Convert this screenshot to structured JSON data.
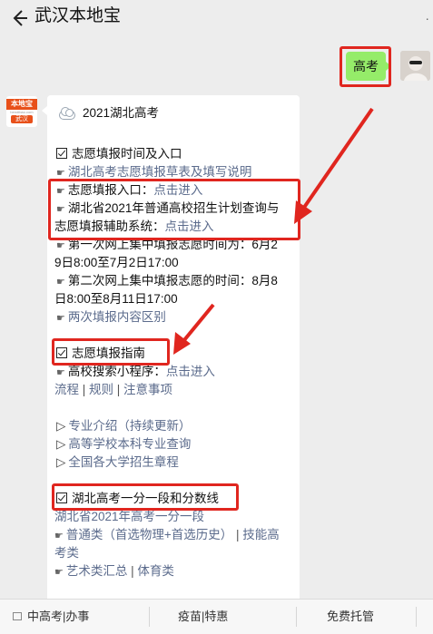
{
  "header": {
    "title": "武汉本地宝",
    "more": "·"
  },
  "chat": {
    "user_message": "高考",
    "bot_avatar": {
      "brand": "本地宝",
      "site": "bendibao.com",
      "city": "武汉"
    }
  },
  "card": {
    "heading": "2021湖北高考",
    "sec1_title": "志愿填报时间及入口",
    "sec1_link1": "湖北高考志愿填报草表及填写说明",
    "entry1_label": "志愿填报入口：",
    "entry1_link": "点击进入",
    "entry2_line1": "湖北省2021年普通高校招生计划查询与",
    "entry2_line2_label": "志愿填报辅助系统：",
    "entry2_link": "点击进入",
    "first_round_line1": "第一次网上集中填报志愿时间为：6月2",
    "first_round_line2": "9日8:00至7月2日17:00",
    "second_round_line1": "第二次网上集中填报志愿的时间：8月8",
    "second_round_line2": "日8:00至8月11日17:00",
    "diff_link": "两次填报内容区别",
    "sec2_title": "志愿填报指南",
    "school_search_label": "高校搜索小程序：",
    "school_search_link": "点击进入",
    "guide_links": [
      "流程",
      "规则",
      "注意事项"
    ],
    "tri_links": [
      "专业介绍（持续更新）",
      "高等学校本科专业查询",
      "全国各大学招生章程"
    ],
    "sec3_title": "湖北高考一分一段和分数线",
    "score_link1": "湖北省2021年高考一分一段",
    "score_general_label": "普通类（首选物理+首选历史）",
    "score_tech_line1": "技能高",
    "score_tech_line2": "考类",
    "score_art": "艺术类汇总",
    "score_sport": "体育类"
  },
  "bottom_menu": {
    "items": [
      "中高考|办事",
      "疫苗|特惠",
      "免费托管"
    ]
  },
  "colors": {
    "highlight_red": "#e0261f",
    "bubble_green": "#95ec69",
    "link_blue": "#5b6b8c"
  }
}
